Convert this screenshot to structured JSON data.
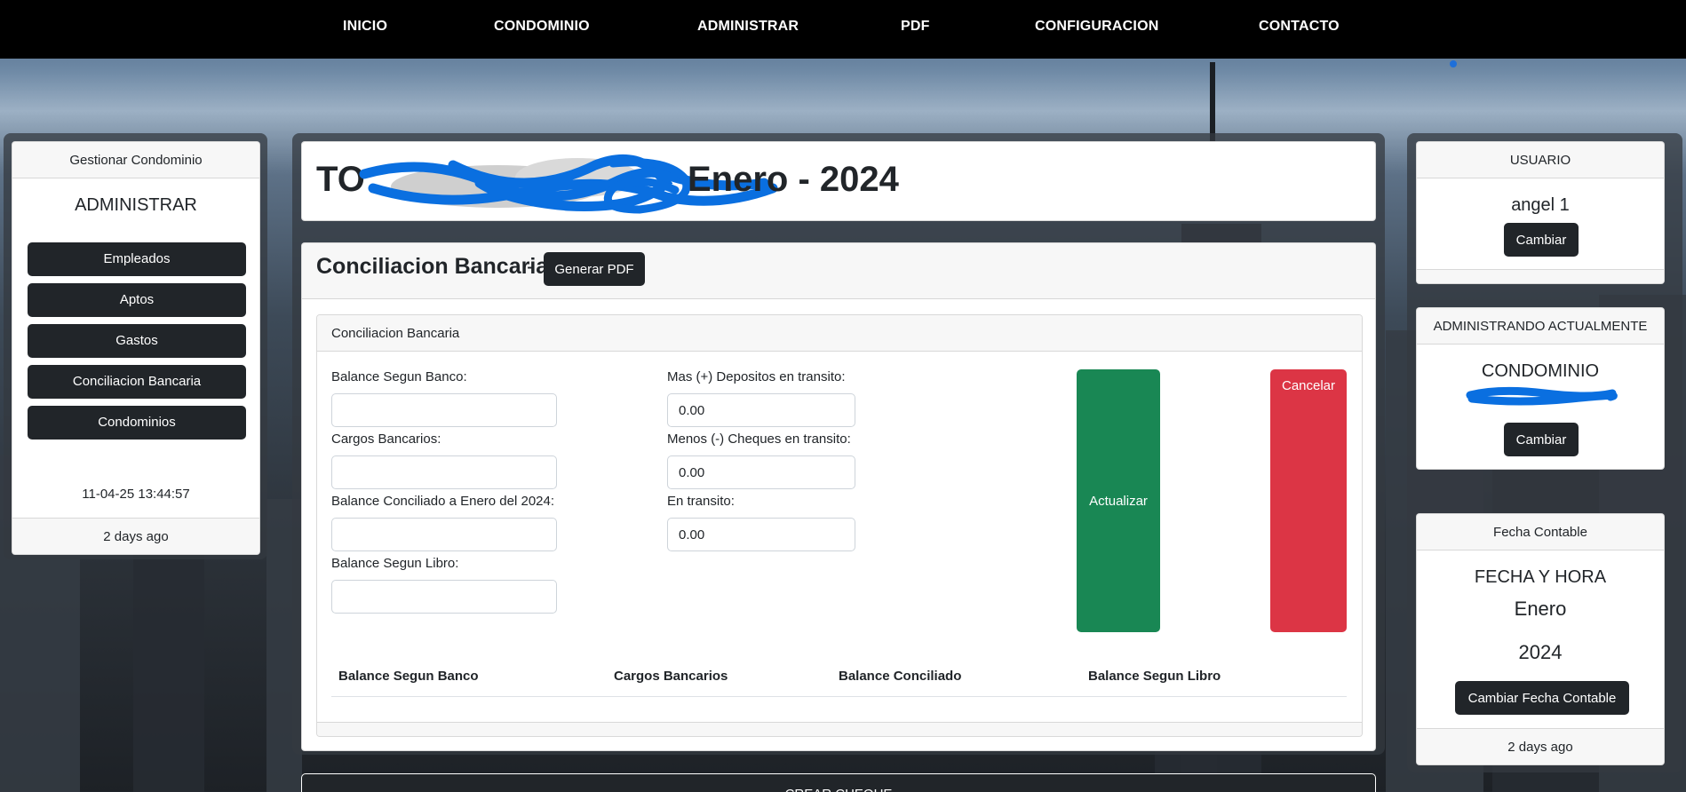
{
  "nav": {
    "items": [
      "INICIO",
      "CONDOMINIO",
      "ADMINISTRAR",
      "PDF",
      "CONFIGURACION",
      "CONTACTO"
    ]
  },
  "left_panel": {
    "header": "Gestionar Condominio",
    "title": "ADMINISTRAR",
    "buttons": [
      "Empleados",
      "Aptos",
      "Gastos",
      "Conciliacion Bancaria",
      "Condominios"
    ],
    "timestamp": "11-04-25 13:44:57",
    "footer": "2 days ago"
  },
  "title_card": {
    "redacted_prefix": "TO",
    "period": "Enero - 2024"
  },
  "main": {
    "heading": "Conciliacion Bancaria",
    "separator": "-",
    "pdf_button": "Generar PDF",
    "inner_header": "Conciliacion Bancaria",
    "fields_left": [
      {
        "label": "Balance Segun Banco:",
        "value": ""
      },
      {
        "label": "Cargos Bancarios:",
        "value": ""
      },
      {
        "label": "Balance Conciliado a Enero del 2024:",
        "value": ""
      },
      {
        "label": "Balance Segun Libro:",
        "value": ""
      }
    ],
    "fields_right": [
      {
        "label": "Mas (+) Depositos en transito:",
        "value": "0.00"
      },
      {
        "label": "Menos (-) Cheques en transito:",
        "value": "0.00"
      },
      {
        "label": "En transito:",
        "value": "0.00"
      }
    ],
    "update_button": "Actualizar",
    "cancel_button": "Cancelar",
    "table_headers": [
      "Balance Segun Banco",
      "Cargos Bancarios",
      "Balance Conciliado",
      "Balance Segun Libro"
    ],
    "bottom_button": "CREAR CHEQUE"
  },
  "user_card": {
    "header": "USUARIO",
    "name": "angel 1",
    "button": "Cambiar"
  },
  "admin_card": {
    "header": "ADMINISTRANDO ACTUALMENTE",
    "title": "CONDOMINIO",
    "button": "Cambiar"
  },
  "date_card": {
    "header": "Fecha Contable",
    "title": "FECHA Y HORA",
    "month": "Enero",
    "year": "2024",
    "button": "Cambiar Fecha Contable",
    "footer": "2 days ago"
  },
  "colors": {
    "nav_bg": "#000000",
    "dark_button": "#212529",
    "success": "#198754",
    "danger": "#dc3545",
    "redaction": "#0a6fe0"
  }
}
